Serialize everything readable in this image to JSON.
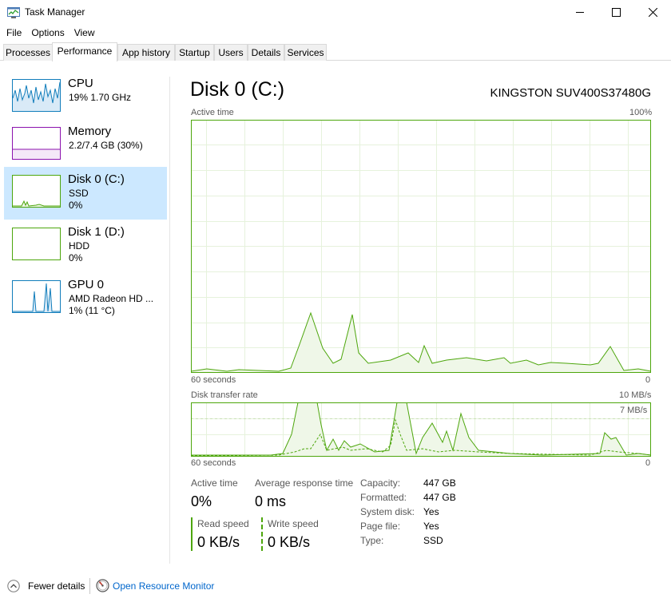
{
  "window": {
    "title": "Task Manager"
  },
  "menu": [
    "File",
    "Options",
    "View"
  ],
  "tabs": [
    {
      "label": "Processes",
      "active": false
    },
    {
      "label": "Performance",
      "active": true
    },
    {
      "label": "App history",
      "active": false
    },
    {
      "label": "Startup",
      "active": false
    },
    {
      "label": "Users",
      "active": false
    },
    {
      "label": "Details",
      "active": false
    },
    {
      "label": "Services",
      "active": false
    }
  ],
  "sidebar": {
    "items": [
      {
        "title": "CPU",
        "lines": [
          "19%  1.70 GHz"
        ],
        "color": "#117dbb"
      },
      {
        "title": "Memory",
        "lines": [
          "2.2/7.4 GB (30%)"
        ],
        "color": "#8b12ae"
      },
      {
        "title": "Disk 0 (C:)",
        "lines": [
          "SSD",
          "0%"
        ],
        "color": "#4da60c",
        "selected": true
      },
      {
        "title": "Disk 1 (D:)",
        "lines": [
          "HDD",
          "0%"
        ],
        "color": "#4da60c"
      },
      {
        "title": "GPU 0",
        "lines": [
          "AMD Radeon HD ...",
          "1% (11 °C)"
        ],
        "color": "#117dbb"
      }
    ]
  },
  "disk": {
    "title": "Disk 0 (C:)",
    "model": "KINGSTON SUV400S37480G",
    "active_chart": {
      "label": "Active time",
      "max_label": "100%",
      "time_label": "60 seconds",
      "zero_label": "0"
    },
    "transfer_chart": {
      "label": "Disk transfer rate",
      "max_label": "10 MB/s",
      "marker_label": "7 MB/s",
      "time_label": "60 seconds",
      "zero_label": "0"
    },
    "stats": {
      "active_time_label": "Active time",
      "active_time_value": "0%",
      "response_label": "Average response time",
      "response_value": "0 ms",
      "read_label": "Read speed",
      "read_value": "0 KB/s",
      "write_label": "Write speed",
      "write_value": "0 KB/s"
    },
    "properties": [
      {
        "label": "Capacity:",
        "value": "447 GB"
      },
      {
        "label": "Formatted:",
        "value": "447 GB"
      },
      {
        "label": "System disk:",
        "value": "Yes"
      },
      {
        "label": "Page file:",
        "value": "Yes"
      },
      {
        "label": "Type:",
        "value": "SSD"
      }
    ]
  },
  "footer": {
    "fewer_details": "Fewer details",
    "open_resource_monitor": "Open Resource Monitor"
  },
  "colors": {
    "disk_line": "#4da60c",
    "disk_fill": "#eff7e8",
    "grid": "#e6f2dc",
    "selection": "#cce8ff",
    "link": "#0066cc"
  }
}
